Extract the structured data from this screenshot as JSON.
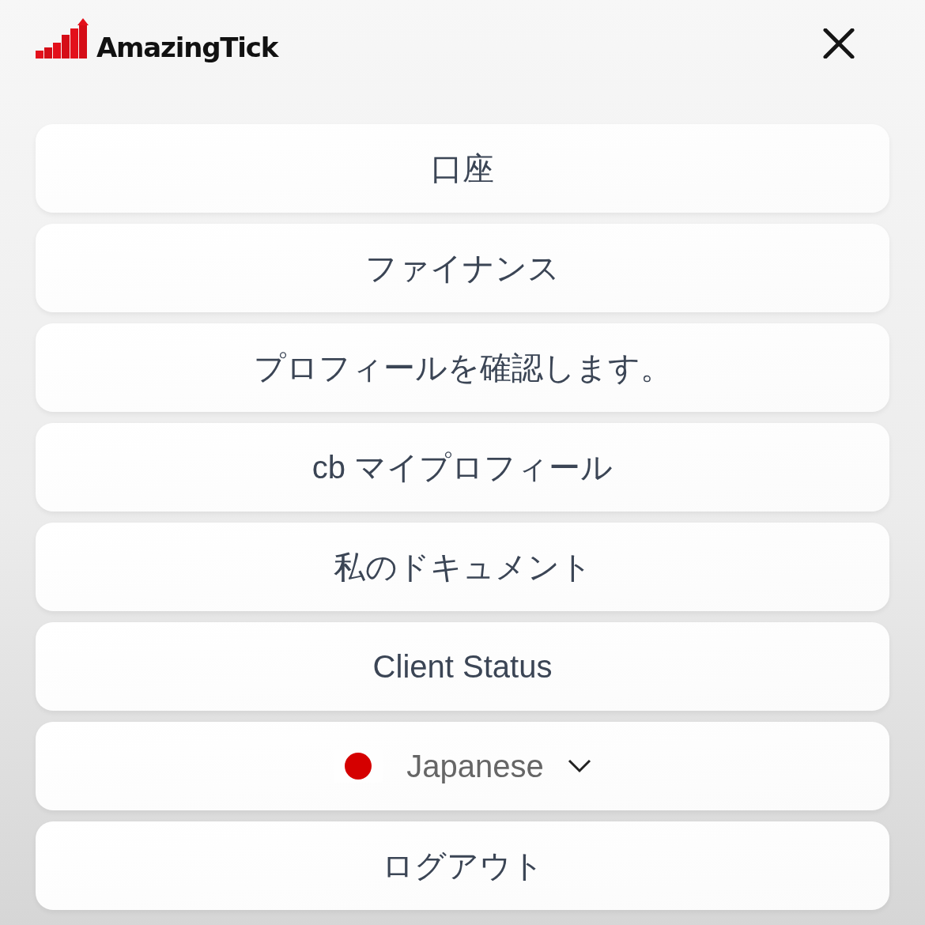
{
  "header": {
    "logo": {
      "text": "AmazingTick"
    }
  },
  "menu": [
    {
      "kind": "link",
      "label": "口座"
    },
    {
      "kind": "link",
      "label": "ファイナンス"
    },
    {
      "kind": "link",
      "label": "プロフィールを確認します。"
    },
    {
      "kind": "link",
      "label": "cb マイプロフィール"
    },
    {
      "kind": "link",
      "label": "私のドキュメント"
    },
    {
      "kind": "link",
      "label": "Client Status"
    },
    {
      "kind": "language",
      "label": "Japanese"
    },
    {
      "kind": "link",
      "label": "ログアウト"
    }
  ]
}
